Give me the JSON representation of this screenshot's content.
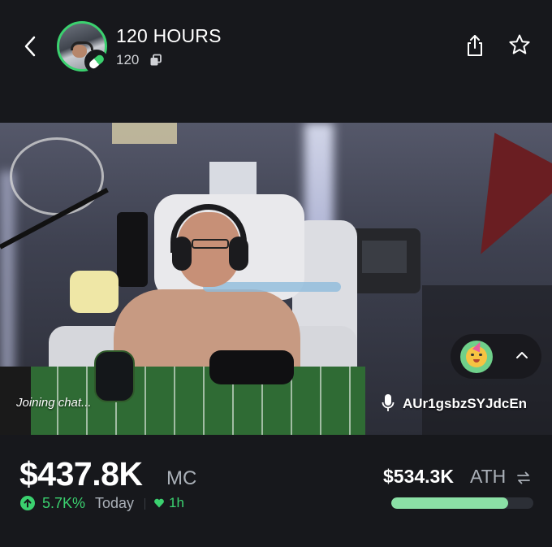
{
  "header": {
    "title": "120 HOURS",
    "ticker": "120",
    "icons": {
      "back": "chevron-left-icon",
      "copy": "copy-icon",
      "share": "share-icon",
      "favorite": "star-icon",
      "badge": "pill-icon"
    }
  },
  "stream": {
    "chat_status": "Joining chat...",
    "host_address": "AUr1gsbzSYJdcEn",
    "icons": {
      "mic": "microphone-icon",
      "react": "party-face-emoji",
      "expand": "chevron-up-icon"
    }
  },
  "stats": {
    "market_cap": "$437.8K",
    "market_cap_label": "MC",
    "change_pct": "5.7K%",
    "change_period": "Today",
    "timeframe": "1h",
    "ath_value": "$534.3K",
    "ath_label": "ATH",
    "ath_progress": 0.82
  },
  "colors": {
    "background": "#17181c",
    "accent_green": "#3bd16f",
    "progress_fill": "#8be0a6",
    "muted_text": "#aab0b8"
  }
}
